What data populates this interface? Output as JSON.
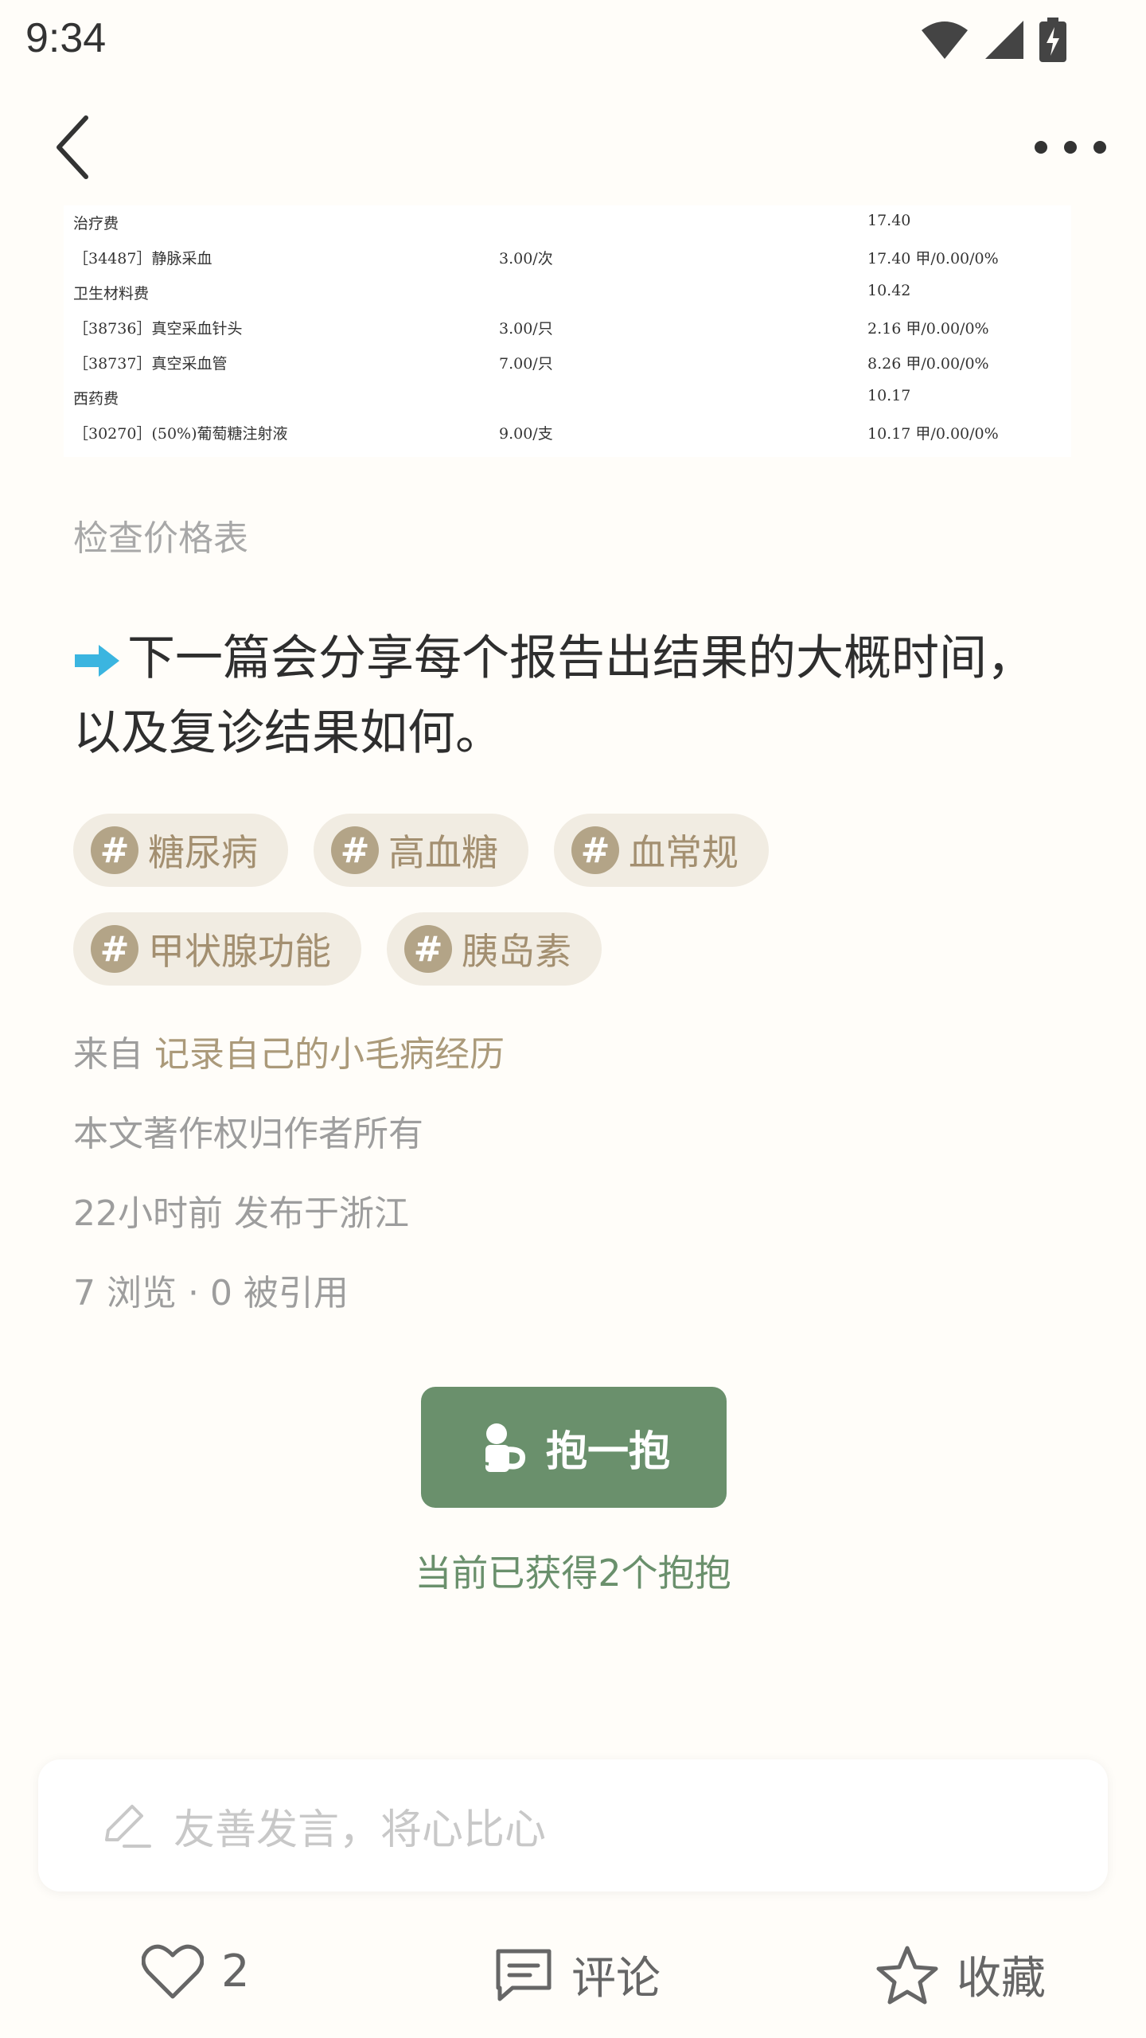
{
  "status_bar": {
    "time": "9:34"
  },
  "receipt": {
    "rows": [
      {
        "name": "治疗费",
        "price": "",
        "amount": "17.40"
      },
      {
        "name": "［34487］静脉采血",
        "price": "3.00/次",
        "amount": "17.40  甲/0.00/0%"
      },
      {
        "name": "卫生材料费",
        "price": "",
        "amount": "10.42"
      },
      {
        "name": "［38736］真空采血针头",
        "price": "3.00/只",
        "amount": " 2.16  甲/0.00/0%"
      },
      {
        "name": "［38737］真空采血管",
        "price": "7.00/只",
        "amount": " 8.26  甲/0.00/0%"
      },
      {
        "name": "西药费",
        "price": "",
        "amount": "10.17"
      },
      {
        "name": "［30270］(50%)葡萄糖注射液",
        "price": "9.00/支",
        "amount": "10.17  甲/0.00/0%"
      }
    ]
  },
  "caption": "检查价格表",
  "highlight": "下一篇会分享每个报告出结果的大概时间，以及复诊结果如何。",
  "tags": [
    {
      "label": "糖尿病",
      "icon": "#"
    },
    {
      "label": "高血糖",
      "icon": "#"
    },
    {
      "label": "血常规",
      "icon": "#"
    },
    {
      "label": "甲状腺功能",
      "icon": "#"
    },
    {
      "label": "胰岛素",
      "icon": "#"
    }
  ],
  "meta": {
    "from_prefix": "来自",
    "from_source": "记录自己的小毛病经历",
    "copyright": "本文著作权归作者所有",
    "published": "22小时前 发布于浙江",
    "stats": "7 浏览 · 0 被引用"
  },
  "hug": {
    "label": "抱一抱",
    "count_text": "当前已获得2个抱抱"
  },
  "comment": {
    "placeholder": "友善发言，将心比心"
  },
  "bottom_bar": {
    "like_count": "2",
    "comment_label": "评论",
    "favorite_label": "收藏"
  },
  "colors": {
    "accent": "#6a906c",
    "tag_bg": "#f1ece2",
    "tag_icon": "#b3a487",
    "arrow": "#3bb5e0"
  }
}
